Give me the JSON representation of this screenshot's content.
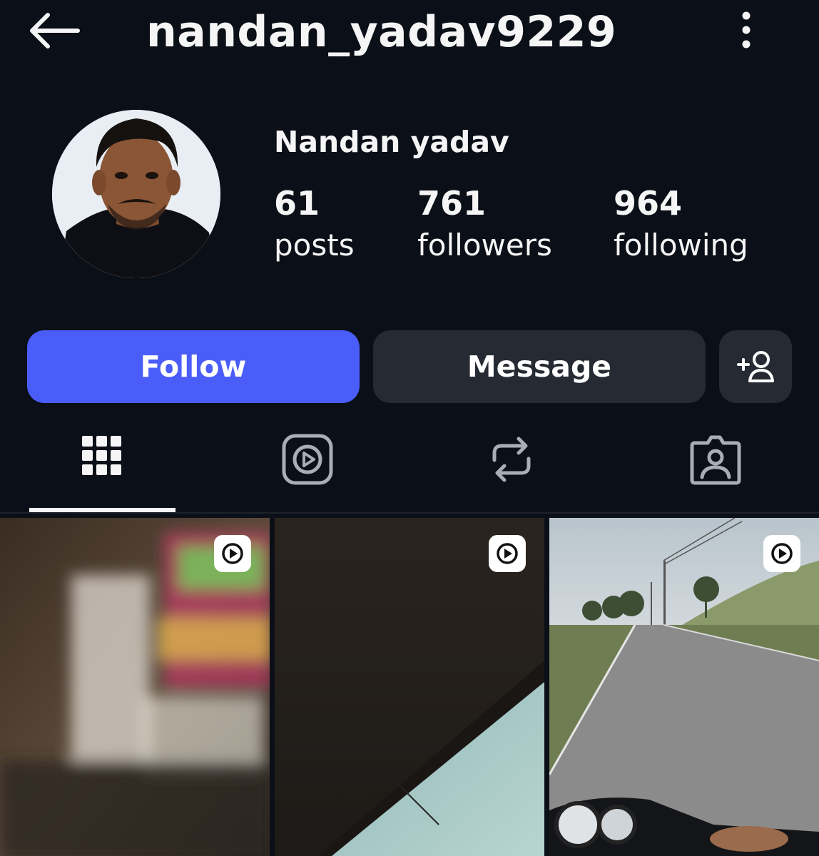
{
  "header": {
    "back_icon": "arrow-left-icon",
    "username": "nandan_yadav9229",
    "more_icon": "more-vertical-icon"
  },
  "profile": {
    "display_name": "Nandan yadav",
    "stats": {
      "posts": {
        "value": "61",
        "label": "posts"
      },
      "followers": {
        "value": "761",
        "label": "followers"
      },
      "following": {
        "value": "964",
        "label": "following"
      }
    }
  },
  "actions": {
    "follow_label": "Follow",
    "message_label": "Message",
    "suggest_icon": "add-person-icon"
  },
  "tabs": [
    {
      "icon": "grid-icon",
      "active": true
    },
    {
      "icon": "reels-icon",
      "active": false
    },
    {
      "icon": "repost-icon",
      "active": false
    },
    {
      "icon": "tagged-icon",
      "active": false
    }
  ],
  "posts": [
    {
      "type": "reel",
      "badge_icon": "reel-play-icon",
      "scene": "blurry night market lights"
    },
    {
      "type": "reel",
      "badge_icon": "reel-play-icon",
      "scene": "dark tilted wall with sky"
    },
    {
      "type": "reel",
      "badge_icon": "reel-play-icon",
      "scene": "motorbike ride on rural road"
    }
  ],
  "colors": {
    "background": "#0b0f17",
    "follow_button": "#4a5df9",
    "secondary_button": "#262a33",
    "text": "#f5f5f5",
    "icon_inactive": "#a8adb6"
  }
}
